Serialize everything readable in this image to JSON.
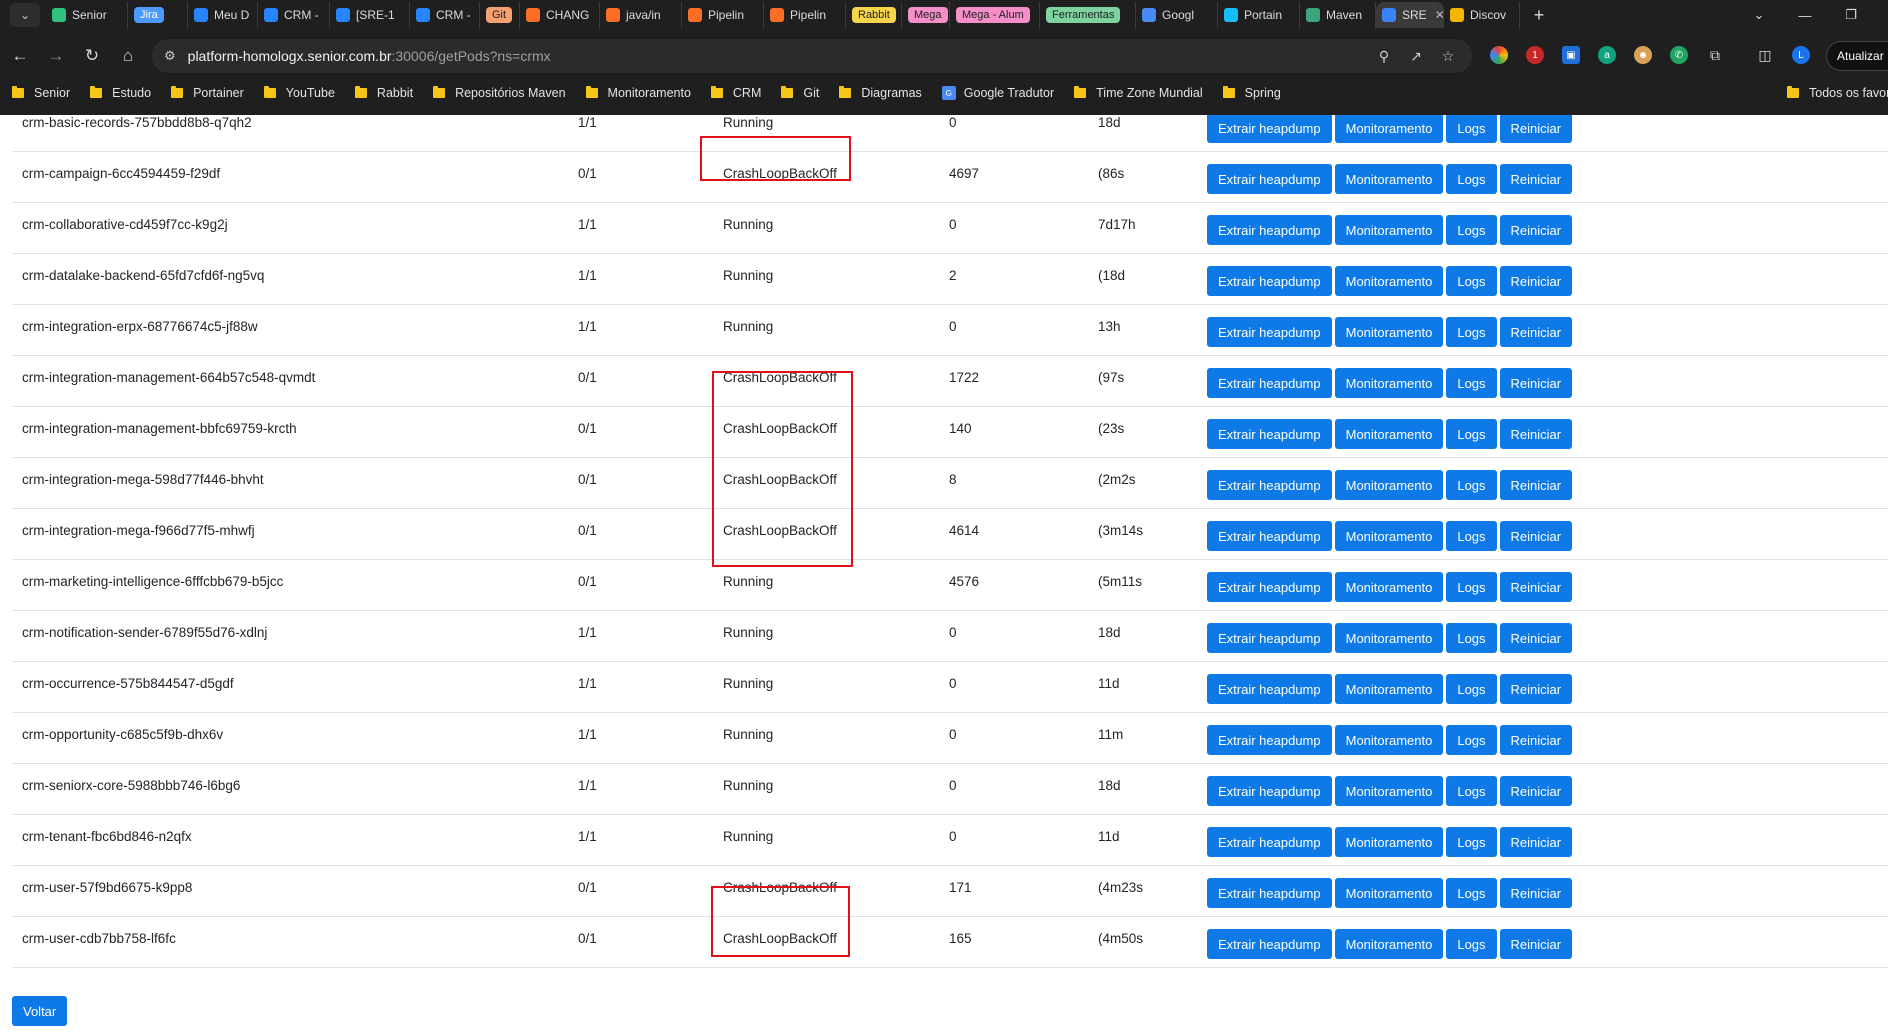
{
  "browser": {
    "tabs": [
      {
        "label": "Senior",
        "icon": "senior-icon",
        "color": "#2ec27e"
      },
      {
        "label": "Jira",
        "icon": "pill",
        "pill_bg": "#4c9aff",
        "pill_fg": "#ffffff"
      },
      {
        "label": "Meu D",
        "icon": "jira-icon",
        "color": "#2684ff"
      },
      {
        "label": "CRM -",
        "icon": "jira-icon",
        "color": "#2684ff"
      },
      {
        "label": "[SRE-1",
        "icon": "jira-icon",
        "color": "#2684ff"
      },
      {
        "label": "CRM -",
        "icon": "jira-icon",
        "color": "#2684ff"
      },
      {
        "label": "Git",
        "icon": "pill",
        "pill_bg": "#f5a070",
        "pill_fg": "#1f1f1f"
      },
      {
        "label": "CHANG",
        "icon": "gitlab-icon",
        "color": "#fc6d26"
      },
      {
        "label": "java/in",
        "icon": "gitlab-icon",
        "color": "#fc6d26"
      },
      {
        "label": "Pipelin",
        "icon": "gitlab-icon",
        "color": "#fc6d26"
      },
      {
        "label": "Pipelin",
        "icon": "gitlab-icon",
        "color": "#fc6d26"
      },
      {
        "label": "Rabbit",
        "icon": "pill",
        "pill_bg": "#f7d54a",
        "pill_fg": "#1f1f1f"
      },
      {
        "label": "Mega",
        "icon": "pill",
        "pill_bg": "#f48fc8",
        "pill_fg": "#1f1f1f"
      },
      {
        "label": "Mega - Alum",
        "icon": "pill",
        "pill_bg": "#f48fc8",
        "pill_fg": "#1f1f1f"
      },
      {
        "label": "Ferramentas",
        "icon": "pill",
        "pill_bg": "#7ed3a0",
        "pill_fg": "#1f1f1f"
      },
      {
        "label": "Googl",
        "icon": "google-translate-icon",
        "color": "#4a8af4"
      },
      {
        "label": "Portain",
        "icon": "portainer-icon",
        "color": "#13bef9"
      },
      {
        "label": "Maven",
        "icon": "maven-icon",
        "color": "#3aa57a"
      },
      {
        "label": "SRE",
        "icon": "sre-icon",
        "color": "#3b82f6",
        "active": true
      },
      {
        "label": "Discov",
        "icon": "discover-icon",
        "color": "#f4b400"
      }
    ],
    "url_host": "platform-homologx.senior.com.br",
    "url_path": ":30006/getPods?ns=crmx",
    "update_label": "Atualizar",
    "bookmarks": [
      {
        "label": "Senior",
        "icon": "folder-icon"
      },
      {
        "label": "Estudo",
        "icon": "folder-icon"
      },
      {
        "label": "Portainer",
        "icon": "folder-icon"
      },
      {
        "label": "YouTube",
        "icon": "folder-icon"
      },
      {
        "label": "Rabbit",
        "icon": "folder-icon"
      },
      {
        "label": "Repositórios Maven",
        "icon": "folder-icon"
      },
      {
        "label": "Monitoramento",
        "icon": "folder-icon"
      },
      {
        "label": "CRM",
        "icon": "folder-icon"
      },
      {
        "label": "Git",
        "icon": "folder-icon"
      },
      {
        "label": "Diagramas",
        "icon": "folder-icon"
      },
      {
        "label": "Google Tradutor",
        "icon": "google-translate-icon"
      },
      {
        "label": "Time Zone Mundial",
        "icon": "folder-icon"
      },
      {
        "label": "Spring",
        "icon": "folder-icon"
      }
    ],
    "all_bookmarks_label": "Todos os favoritos"
  },
  "actions": {
    "heapdump": "Extrair heapdump",
    "monitoring": "Monitoramento",
    "logs": "Logs",
    "restart": "Reiniciar"
  },
  "pods": [
    {
      "name": "crm-basic-records-757bbdd8b8-q7qh2",
      "ready": "1/1",
      "status": "Running",
      "restarts": "0",
      "age": "18d"
    },
    {
      "name": "crm-campaign-6cc4594459-f29df",
      "ready": "0/1",
      "status": "CrashLoopBackOff",
      "restarts": "4697",
      "age": "(86s"
    },
    {
      "name": "crm-collaborative-cd459f7cc-k9g2j",
      "ready": "1/1",
      "status": "Running",
      "restarts": "0",
      "age": "7d17h"
    },
    {
      "name": "crm-datalake-backend-65fd7cfd6f-ng5vq",
      "ready": "1/1",
      "status": "Running",
      "restarts": "2",
      "age": "(18d"
    },
    {
      "name": "crm-integration-erpx-68776674c5-jf88w",
      "ready": "1/1",
      "status": "Running",
      "restarts": "0",
      "age": "13h"
    },
    {
      "name": "crm-integration-management-664b57c548-qvmdt",
      "ready": "0/1",
      "status": "CrashLoopBackOff",
      "restarts": "1722",
      "age": "(97s"
    },
    {
      "name": "crm-integration-management-bbfc69759-krcth",
      "ready": "0/1",
      "status": "CrashLoopBackOff",
      "restarts": "140",
      "age": "(23s"
    },
    {
      "name": "crm-integration-mega-598d77f446-bhvht",
      "ready": "0/1",
      "status": "CrashLoopBackOff",
      "restarts": "8",
      "age": "(2m2s"
    },
    {
      "name": "crm-integration-mega-f966d77f5-mhwfj",
      "ready": "0/1",
      "status": "CrashLoopBackOff",
      "restarts": "4614",
      "age": "(3m14s"
    },
    {
      "name": "crm-marketing-intelligence-6fffcbb679-b5jcc",
      "ready": "0/1",
      "status": "Running",
      "restarts": "4576",
      "age": "(5m11s"
    },
    {
      "name": "crm-notification-sender-6789f55d76-xdlnj",
      "ready": "1/1",
      "status": "Running",
      "restarts": "0",
      "age": "18d"
    },
    {
      "name": "crm-occurrence-575b844547-d5gdf",
      "ready": "1/1",
      "status": "Running",
      "restarts": "0",
      "age": "11d"
    },
    {
      "name": "crm-opportunity-c685c5f9b-dhx6v",
      "ready": "1/1",
      "status": "Running",
      "restarts": "0",
      "age": "11m"
    },
    {
      "name": "crm-seniorx-core-5988bbb746-l6bg6",
      "ready": "1/1",
      "status": "Running",
      "restarts": "0",
      "age": "18d"
    },
    {
      "name": "crm-tenant-fbc6bd846-n2qfx",
      "ready": "1/1",
      "status": "Running",
      "restarts": "0",
      "age": "11d"
    },
    {
      "name": "crm-user-57f9bd6675-k9pp8",
      "ready": "0/1",
      "status": "CrashLoopBackOff",
      "restarts": "171",
      "age": "(4m23s"
    },
    {
      "name": "crm-user-cdb7bb758-lf6fc",
      "ready": "0/1",
      "status": "CrashLoopBackOff",
      "restarts": "165",
      "age": "(4m50s"
    }
  ],
  "back_label": "Voltar",
  "colors": {
    "button": "#0d7ae8",
    "highlight_box": "#e0101a",
    "chrome_bg": "#1f1f1f"
  }
}
